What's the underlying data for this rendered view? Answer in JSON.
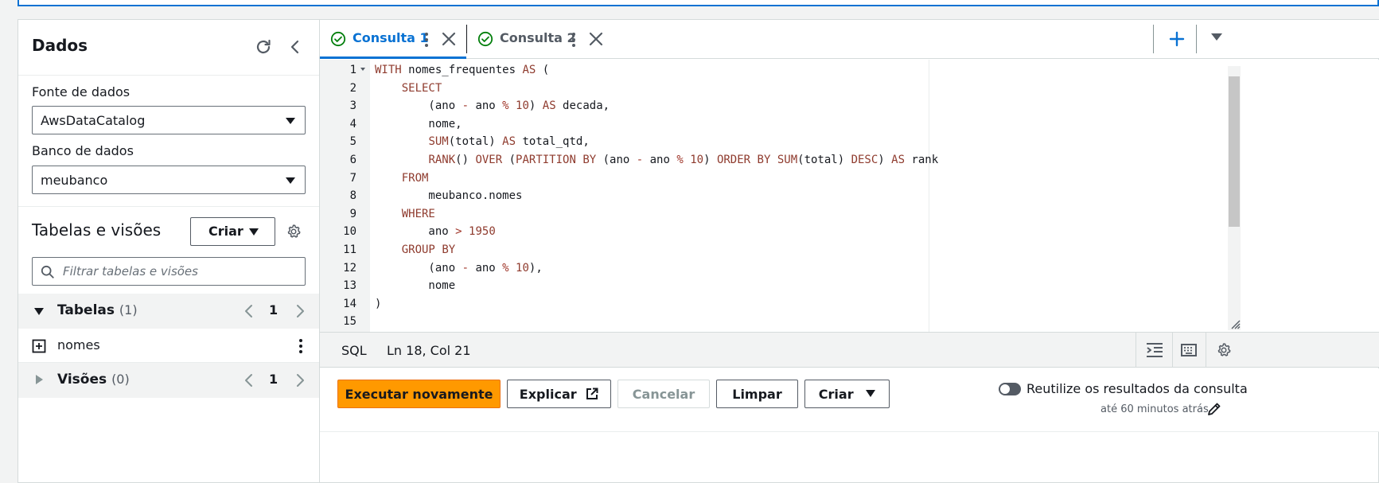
{
  "left_panel": {
    "title": "Dados",
    "data_source_label": "Fonte de dados",
    "data_source_value": "AwsDataCatalog",
    "database_label": "Banco de dados",
    "database_value": "meubanco",
    "tables_views_title": "Tabelas e visões",
    "create_label": "Criar",
    "filter_placeholder": "Filtrar tabelas e visões",
    "tables": {
      "label": "Tabelas",
      "count": "(1)",
      "page": "1"
    },
    "table_items": [
      {
        "name": "nomes"
      }
    ],
    "views": {
      "label": "Visões",
      "count": "(0)",
      "page": "1"
    }
  },
  "tabs": [
    {
      "label": "Consulta 1",
      "status_icon": "check-circle-icon"
    },
    {
      "label": "Consulta 2",
      "status_icon": "check-circle-icon"
    }
  ],
  "editor": {
    "line_numbers": [
      "1",
      "2",
      "3",
      "4",
      "5",
      "6",
      "7",
      "8",
      "9",
      "10",
      "11",
      "12",
      "13",
      "14",
      "15"
    ],
    "lines": [
      "WITH nomes_frequentes AS (",
      "    SELECT",
      "        (ano - ano % 10) AS decada,",
      "        nome,",
      "        SUM(total) AS total_qtd,",
      "        RANK() OVER (PARTITION BY (ano - ano % 10) ORDER BY SUM(total) DESC) AS rank",
      "    FROM",
      "        meubanco.nomes",
      "    WHERE",
      "        ano > 1950",
      "    GROUP BY",
      "        (ano - ano % 10),",
      "        nome",
      ")",
      ""
    ],
    "keyword_color": "#8f3b2e"
  },
  "status": {
    "language": "SQL",
    "position": "Ln 18, Col 21"
  },
  "actions": {
    "run_again": "Executar novamente",
    "explain": "Explicar",
    "cancel": "Cancelar",
    "clear": "Limpar",
    "create": "Criar",
    "reuse_label": "Reutilize os resultados da consulta",
    "reuse_sub": "até 60 minutos atrás"
  },
  "colors": {
    "accent": "#0972d3",
    "primary_button": "#ff9900",
    "success": "#037f0c"
  }
}
